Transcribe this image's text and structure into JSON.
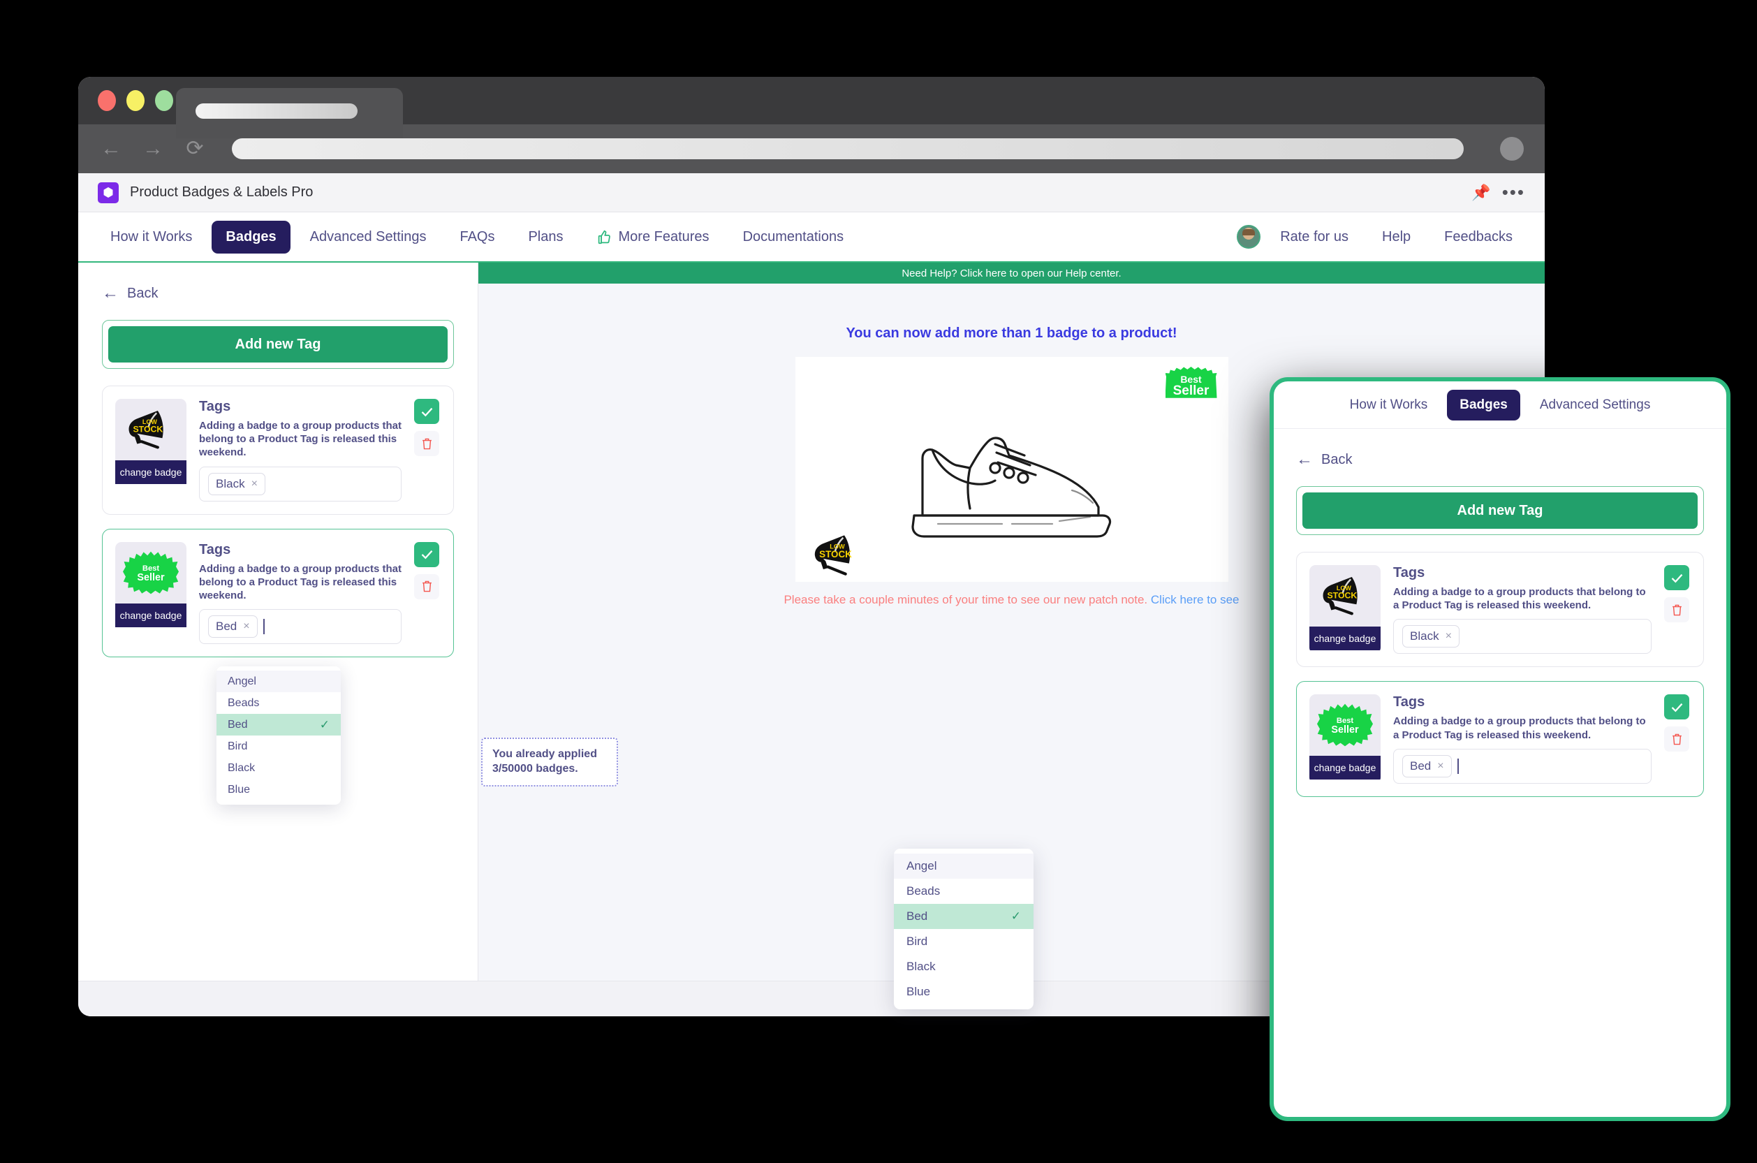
{
  "browser": {
    "back_icon": "arrow-left-icon",
    "forward_icon": "arrow-right-icon",
    "reload_icon": "reload-icon",
    "address_value": "",
    "address_placeholder": ""
  },
  "app": {
    "title": "Product Badges & Labels Pro",
    "logo_color": "#7c2ae8",
    "pin_icon": "pin-icon",
    "more_icon": "more-dots-icon"
  },
  "nav": {
    "items": [
      {
        "label": "How it Works",
        "active": false
      },
      {
        "label": "Badges",
        "active": true
      },
      {
        "label": "Advanced Settings",
        "active": false
      },
      {
        "label": "FAQs",
        "active": false
      },
      {
        "label": "Plans",
        "active": false
      },
      {
        "label": "More Features",
        "active": false,
        "icon": "thumbs-up-icon"
      },
      {
        "label": "Documentations",
        "active": false
      }
    ],
    "right_items": [
      {
        "label": "Rate for us",
        "icon": "avatar-icon"
      },
      {
        "label": "Help"
      },
      {
        "label": "Feedbacks"
      }
    ]
  },
  "sidebar": {
    "back_label": "Back",
    "add_tag_label": "Add new Tag",
    "cards": [
      {
        "badge_type": "low-stock-megaphone",
        "badge_line1": "LOW",
        "badge_line2": "STOCK",
        "change_badge_label": "change badge",
        "title": "Tags",
        "description": "Adding a badge to a group products that belong to a Product Tag is released this weekend.",
        "chips": [
          "Black"
        ],
        "selected": false,
        "show_caret": false
      },
      {
        "badge_type": "best-seller-starburst",
        "badge_line1": "Best",
        "badge_line2": "Seller",
        "change_badge_label": "change badge",
        "title": "Tags",
        "description": "Adding a badge to a group products that belong to a Product Tag is released this weekend.",
        "chips": [
          "Bed"
        ],
        "selected": true,
        "show_caret": true
      }
    ]
  },
  "dropdown": {
    "options": [
      {
        "label": "Angel",
        "state": "hover"
      },
      {
        "label": "Beads",
        "state": "normal"
      },
      {
        "label": "Bed",
        "state": "selected"
      },
      {
        "label": "Bird",
        "state": "normal"
      },
      {
        "label": "Black",
        "state": "normal"
      },
      {
        "label": "Blue",
        "state": "normal"
      }
    ],
    "check_glyph": "✓"
  },
  "main": {
    "help_banner": "Need Help? Click here to open our Help center.",
    "promo_text": "You can now add more than 1 badge to a product!",
    "preview": {
      "best_seller_line1": "Best",
      "best_seller_line2": "Seller",
      "low_stock_line1": "LOW",
      "low_stock_line2": "STOCK"
    },
    "patch_note_text": "Please take a couple minutes of your time to see our new patch note. ",
    "patch_note_link": "Click here to see",
    "counter_text": "You already applied 3/50000 badges."
  },
  "mobile": {
    "nav_items": [
      {
        "label": "How it Works",
        "active": false
      },
      {
        "label": "Badges",
        "active": true
      },
      {
        "label": "Advanced Settings",
        "active": false
      }
    ],
    "back_label": "Back",
    "add_tag_label": "Add new Tag"
  },
  "colors": {
    "green": "#22a06b",
    "green_bright": "#18d346",
    "navy": "#251d5e",
    "purple_text": "#514f86",
    "red": "#fa7f7f",
    "blue_link": "#5a9ef7",
    "promo_blue": "#3a3ae0",
    "yellow": "#f5d000"
  }
}
